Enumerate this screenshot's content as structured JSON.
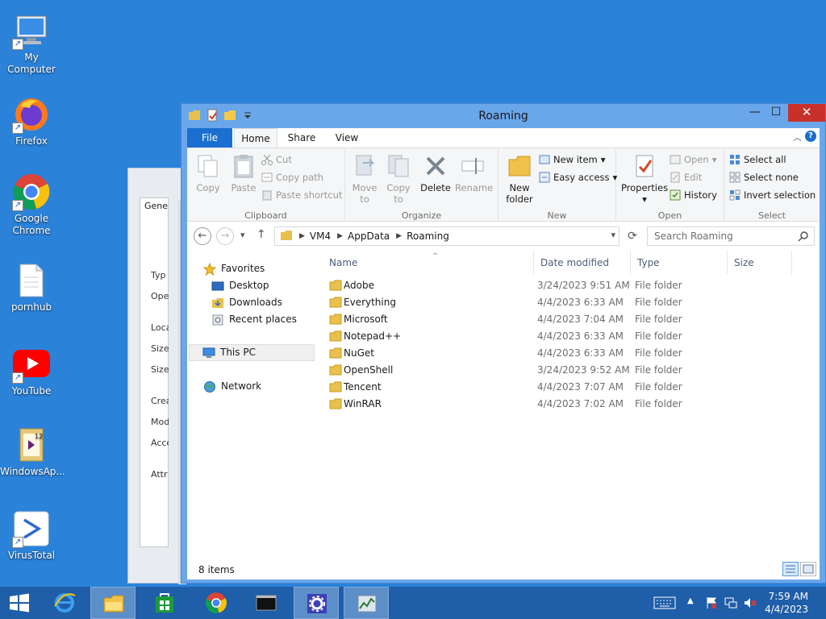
{
  "desktop": {
    "icons": [
      {
        "label": "My Computer",
        "icon": "computer-icon"
      },
      {
        "label": "Firefox",
        "icon": "firefox-icon"
      },
      {
        "label": "Google Chrome",
        "icon": "chrome-icon"
      },
      {
        "label": "pornhub",
        "icon": "text-file-icon"
      },
      {
        "label": "YouTube",
        "icon": "youtube-icon"
      },
      {
        "label": "WindowsAp...",
        "icon": "visual-studio-icon"
      },
      {
        "label": "VirusTotal",
        "icon": "virustotal-icon"
      }
    ]
  },
  "background_window": {
    "tab": "Gene",
    "labels": [
      "Typ",
      "Ope",
      "Loca",
      "Size",
      "Size",
      "Crea",
      "Mod",
      "Acce",
      "Attr"
    ]
  },
  "explorer": {
    "title": "Roaming",
    "controls": {
      "minimize": "—",
      "maximize": "☐",
      "close": "✕"
    },
    "tabs": {
      "file": "File",
      "home": "Home",
      "share": "Share",
      "view": "View"
    },
    "ribbon": {
      "clipboard": {
        "group": "Clipboard",
        "copy": "Copy",
        "paste": "Paste",
        "cut": "Cut",
        "copy_path": "Copy path",
        "paste_shortcut": "Paste shortcut"
      },
      "organize": {
        "group": "Organize",
        "move_to": "Move to",
        "copy_to": "Copy to",
        "delete": "Delete",
        "rename": "Rename"
      },
      "new": {
        "group": "New",
        "new_folder": "New folder",
        "new_item": "New item",
        "easy_access": "Easy access"
      },
      "open": {
        "group": "Open",
        "properties": "Properties",
        "open": "Open",
        "edit": "Edit",
        "history": "History"
      },
      "select": {
        "group": "Select",
        "select_all": "Select all",
        "select_none": "Select none",
        "invert_selection": "Invert selection"
      }
    },
    "address": {
      "crumbs": [
        "VM4",
        "AppData",
        "Roaming"
      ],
      "search_placeholder": "Search Roaming"
    },
    "nav_pane": {
      "favorites": "Favorites",
      "desktop": "Desktop",
      "downloads": "Downloads",
      "recent_places": "Recent places",
      "this_pc": "This PC",
      "network": "Network"
    },
    "columns": {
      "name": "Name",
      "date": "Date modified",
      "type": "Type",
      "size": "Size"
    },
    "files": [
      {
        "name": "Adobe",
        "date": "3/24/2023 9:51 AM",
        "type": "File folder"
      },
      {
        "name": "Everything",
        "date": "4/4/2023 6:33 AM",
        "type": "File folder"
      },
      {
        "name": "Microsoft",
        "date": "4/4/2023 7:04 AM",
        "type": "File folder"
      },
      {
        "name": "Notepad++",
        "date": "4/4/2023 6:33 AM",
        "type": "File folder"
      },
      {
        "name": "NuGet",
        "date": "4/4/2023 6:33 AM",
        "type": "File folder"
      },
      {
        "name": "OpenShell",
        "date": "3/24/2023 9:52 AM",
        "type": "File folder"
      },
      {
        "name": "Tencent",
        "date": "4/4/2023 7:07 AM",
        "type": "File folder"
      },
      {
        "name": "WinRAR",
        "date": "4/4/2023 7:02 AM",
        "type": "File folder"
      }
    ],
    "status": "8 items"
  },
  "taskbar": {
    "items": [
      "start-icon",
      "internet-explorer-icon",
      "file-explorer-icon",
      "store-icon",
      "chrome-icon",
      "console-icon",
      "settings-icon",
      "task-manager-icon"
    ],
    "clock": {
      "time": "7:59 AM",
      "date": "4/4/2023"
    }
  },
  "colors": {
    "desktop": "#2b82d9",
    "title_bar": "#6aa6ea",
    "accent": "#1a6fd0",
    "close": "#c7312a",
    "taskbar": "#1f5ea8"
  }
}
